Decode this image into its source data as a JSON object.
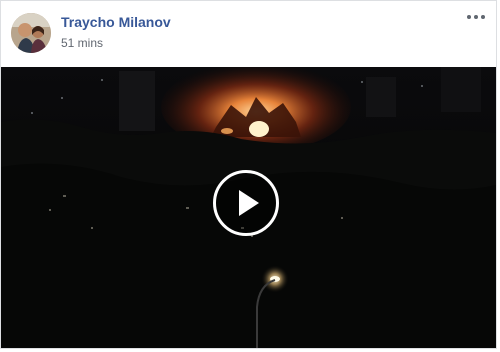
{
  "post": {
    "author_name": "Traycho Milanov",
    "timestamp": "51 mins",
    "avatar_icon": "profile-photo",
    "more_icon": "more-options-icon"
  },
  "video": {
    "play_icon": "play-icon"
  },
  "colors": {
    "author_link": "#385898",
    "meta_text": "#616770",
    "border": "#dddfe2",
    "video_bg": "#050505"
  }
}
